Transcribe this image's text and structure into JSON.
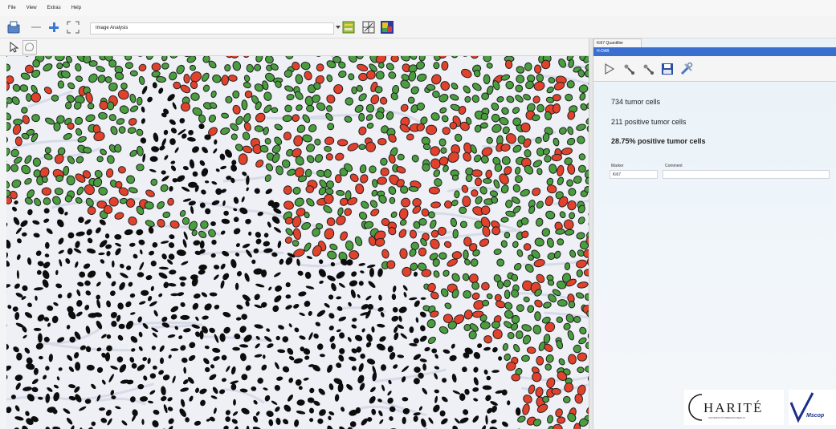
{
  "menu": [
    "File",
    "View",
    "Extras",
    "Help"
  ],
  "toolbar": {
    "analysis_combo": "Image Analysis"
  },
  "panel": {
    "tab": "Ki67 Quantifier",
    "title": "H-DAB",
    "stats": {
      "tumor_cells": "734 tumor cells",
      "positive_tumor_cells": "211 positive tumor cells",
      "percent_positive": "28.75% positive tumor cells"
    },
    "marker_label": "Marker",
    "marker_value": "Ki67",
    "comment_label": "Comment",
    "comment_value": ""
  },
  "logos": {
    "charite": "CHARITÉ",
    "vm": "Mscop"
  },
  "colors": {
    "positive_cell": "#e2422c",
    "negative_cell": "#4a9e3f",
    "stroma_nucleus": "#0d0d0d",
    "panel_title_bar": "#3a6fd0",
    "tissue_background": "#eef0f6"
  }
}
